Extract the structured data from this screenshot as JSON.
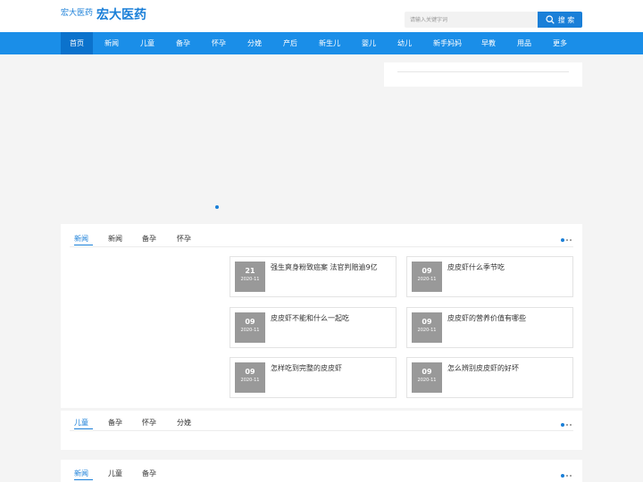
{
  "header": {
    "logo_small": "宏大医药",
    "logo_big": "宏大医药",
    "search_placeholder": "请输入关键字词",
    "search_button": "搜 索",
    "accent": "#1a7fd8"
  },
  "nav": {
    "bg": "#1a8ee8",
    "items": [
      "首页",
      "新闻",
      "儿童",
      "备孕",
      "怀孕",
      "分娩",
      "产后",
      "新生儿",
      "婴儿",
      "幼儿",
      "新手妈妈",
      "早教",
      "用品",
      "更多"
    ],
    "active": "首页"
  },
  "section1": {
    "tabs": [
      "新闻",
      "新闻",
      "备孕",
      "怀孕"
    ],
    "active_tab": "新闻",
    "articles": [
      {
        "day": "21",
        "ym": "2020-11",
        "title": "强生爽身粉致癌案 法官判赔逾9亿"
      },
      {
        "day": "09",
        "ym": "2020-11",
        "title": "皮皮虾什么季节吃"
      },
      {
        "day": "09",
        "ym": "2020-11",
        "title": "皮皮虾不能和什么一起吃"
      },
      {
        "day": "09",
        "ym": "2020-11",
        "title": "皮皮虾的营养价值有哪些"
      },
      {
        "day": "09",
        "ym": "2020-11",
        "title": "怎样吃到完整的皮皮虾"
      },
      {
        "day": "09",
        "ym": "2020-11",
        "title": "怎么辨别皮皮虾的好坏"
      }
    ]
  },
  "section2": {
    "tabs": [
      "儿童",
      "备孕",
      "怀孕",
      "分娩"
    ],
    "active_tab": "儿童"
  },
  "section3": {
    "tabs": [
      "新闻",
      "儿童",
      "备孕"
    ],
    "active_tab": "新闻"
  }
}
